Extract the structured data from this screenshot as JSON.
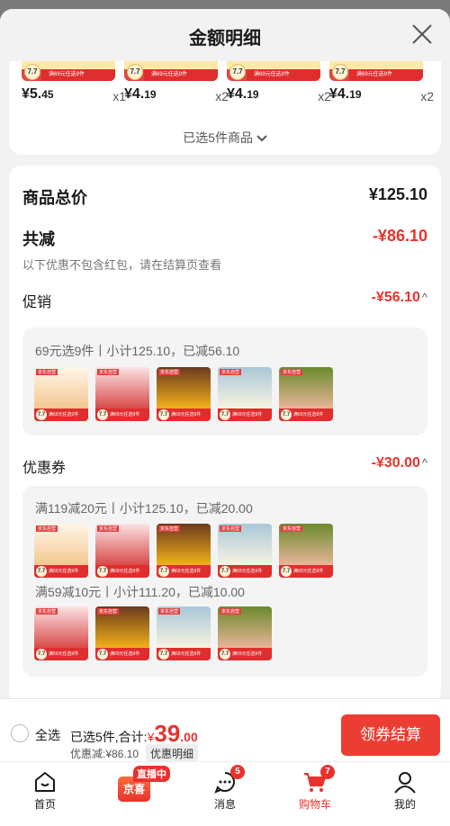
{
  "modal": {
    "title": "金额明细"
  },
  "products": [
    {
      "price_main": "¥5.",
      "price_dec": "45",
      "qty": "x1"
    },
    {
      "price_main": "¥4.",
      "price_dec": "19",
      "qty": "x2"
    },
    {
      "price_main": "¥4.",
      "price_dec": "19",
      "qty": "x2"
    },
    {
      "price_main": "¥4.",
      "price_dec": "19",
      "qty": "x2"
    }
  ],
  "selected_label": "已选5件商品",
  "summary": {
    "total_label": "商品总价",
    "total_value": "¥125.10",
    "reduce_label": "共减",
    "reduce_value": "-¥86.10",
    "note": "以下优惠不包含红包，请在结算页查看",
    "promo_label": "促销",
    "promo_value": "-¥56.10",
    "coupon_label": "优惠券",
    "coupon_value": "-¥30.00"
  },
  "promo_box": {
    "title": "69元选9件丨小计125.10，已减56.10",
    "thumbs": [
      "peach",
      "red",
      "mango",
      "juice",
      "apple"
    ]
  },
  "coupon_box1": {
    "title": "满119减20元丨小计125.10，已减20.00",
    "thumbs": [
      "peach",
      "red",
      "mango",
      "juice",
      "apple"
    ]
  },
  "coupon_box2": {
    "title": "满59减10元丨小计111.20，已减10.00",
    "thumbs": [
      "red",
      "mango",
      "juice",
      "apple"
    ]
  },
  "checkout": {
    "select_all": "全选",
    "selected_text": "已选5件,合计:",
    "currency": "¥",
    "amount_int": "39",
    "amount_dec": ".00",
    "discount_text": "优惠减:¥86.10",
    "detail_button": "优惠明细",
    "pay_button": "领券结算"
  },
  "tabbar": {
    "home": "首页",
    "live_badge": "直播中",
    "jingxi": "京喜",
    "messages": "消息",
    "messages_count": "5",
    "cart": "购物车",
    "cart_count": "7",
    "mine": "我的"
  },
  "colors": {
    "accent": "#e8322d",
    "cart_active": "#e8322d"
  }
}
